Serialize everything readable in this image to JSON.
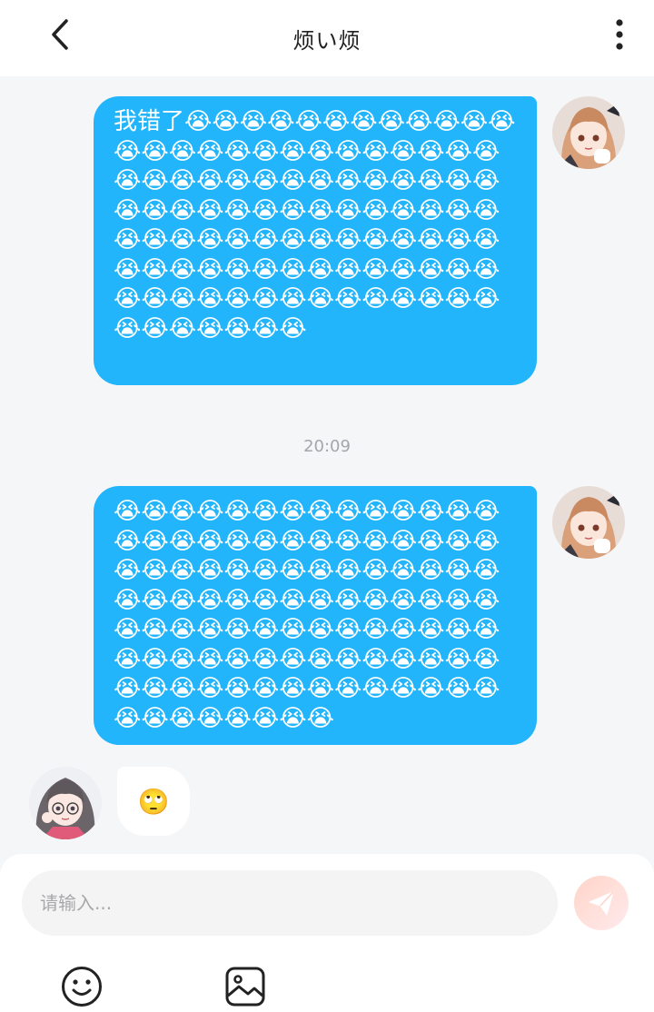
{
  "header": {
    "title": "烦い烦"
  },
  "messages": [
    {
      "direction": "out",
      "text": "我错了😭😭😭😭😭😭😭😭😭😭😭😭😭😭😭😭😭😭😭😭😭😭😭😭😭😭😭😭😭😭😭😭😭😭😭😭😭😭😭😭😭😭😭😭😭😭😭😭😭😭😭😭😭😭😭😭😭😭😭😭😭😭😭😭😭😭😭😭😭😭😭😭😭😭😭😭😭😭😭😭😭😭😭😭😭😭😭😭😭😭😭😭😭😭😭😭😭😭😭😭😭😭😭"
    },
    {
      "direction": "out",
      "text": "😭😭😭😭😭😭😭😭😭😭😭😭😭😭😭😭😭😭😭😭😭😭😭😭😭😭😭😭😭😭😭😭😭😭😭😭😭😭😭😭😭😭😭😭😭😭😭😭😭😭😭😭😭😭😭😭😭😭😭😭😭😭😭😭😭😭😭😭😭😭😭😭😭😭😭😭😭😭😭😭😭😭😭😭😭😭😭😭😭😭😭😭😭😭😭😭😭😭😭😭😭😭😭😭😭😭"
    },
    {
      "direction": "in",
      "text": "🙄"
    }
  ],
  "timestamp": "20:09",
  "composer": {
    "placeholder": "请输入..."
  },
  "icons": {
    "back": "chevron-left-icon",
    "more": "more-vertical-icon",
    "send": "paper-plane-icon",
    "emoji": "smiley-icon",
    "image": "image-icon"
  },
  "colors": {
    "bubble_out": "#22b5fb",
    "send_button": "#ffd3c8",
    "background": "#f5f6f8"
  }
}
